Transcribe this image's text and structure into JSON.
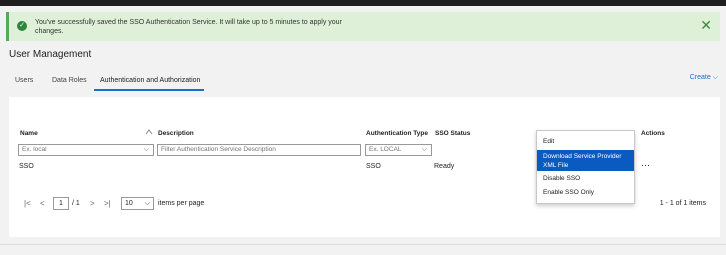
{
  "banner": {
    "message": "You've successfully saved the SSO Authentication Service. It will take up to 5 minutes to apply your changes.",
    "close_symbol": "✕",
    "check_symbol": "✓"
  },
  "page": {
    "title": "User Management"
  },
  "tabs": [
    {
      "label": "Users"
    },
    {
      "label": "Data Roles"
    },
    {
      "label": "Authentication and Authorization"
    }
  ],
  "create_label": "Create",
  "create_chevron": "⌵",
  "table": {
    "headers": {
      "name": "Name",
      "description": "Description",
      "auth_type": "Authentication Type",
      "sso_status": "SSO Status",
      "actions": "Actions"
    },
    "filters": {
      "name_placeholder": "Ex. local",
      "description_placeholder": "Filter Authentication Service Description",
      "auth_type_placeholder": "Ex. LOCAL"
    },
    "rows": [
      {
        "name": "SSO",
        "description": "",
        "auth_type": "SSO",
        "sso_status": "Ready"
      }
    ]
  },
  "actions_menu": {
    "items": [
      {
        "label": "Edit"
      },
      {
        "label": "Download Service Provider XML File"
      },
      {
        "label": "Disable SSO"
      },
      {
        "label": "Enable SSO Only"
      }
    ]
  },
  "pagination": {
    "first": "|<",
    "prev": "<",
    "page": "1",
    "of_text": "/ 1",
    "next": ">",
    "last": ">|",
    "page_size": "10",
    "items_per_page": "items per page",
    "count_text": "1 - 1 of 1 items"
  },
  "icons": {
    "sort": "sort-icon",
    "caret": "chevron-down-icon",
    "kebab": "⋯"
  },
  "colors": {
    "accent": "#1a6fc9",
    "success_bg": "#dff0d8",
    "menu_selected": "#0a5ac2"
  }
}
